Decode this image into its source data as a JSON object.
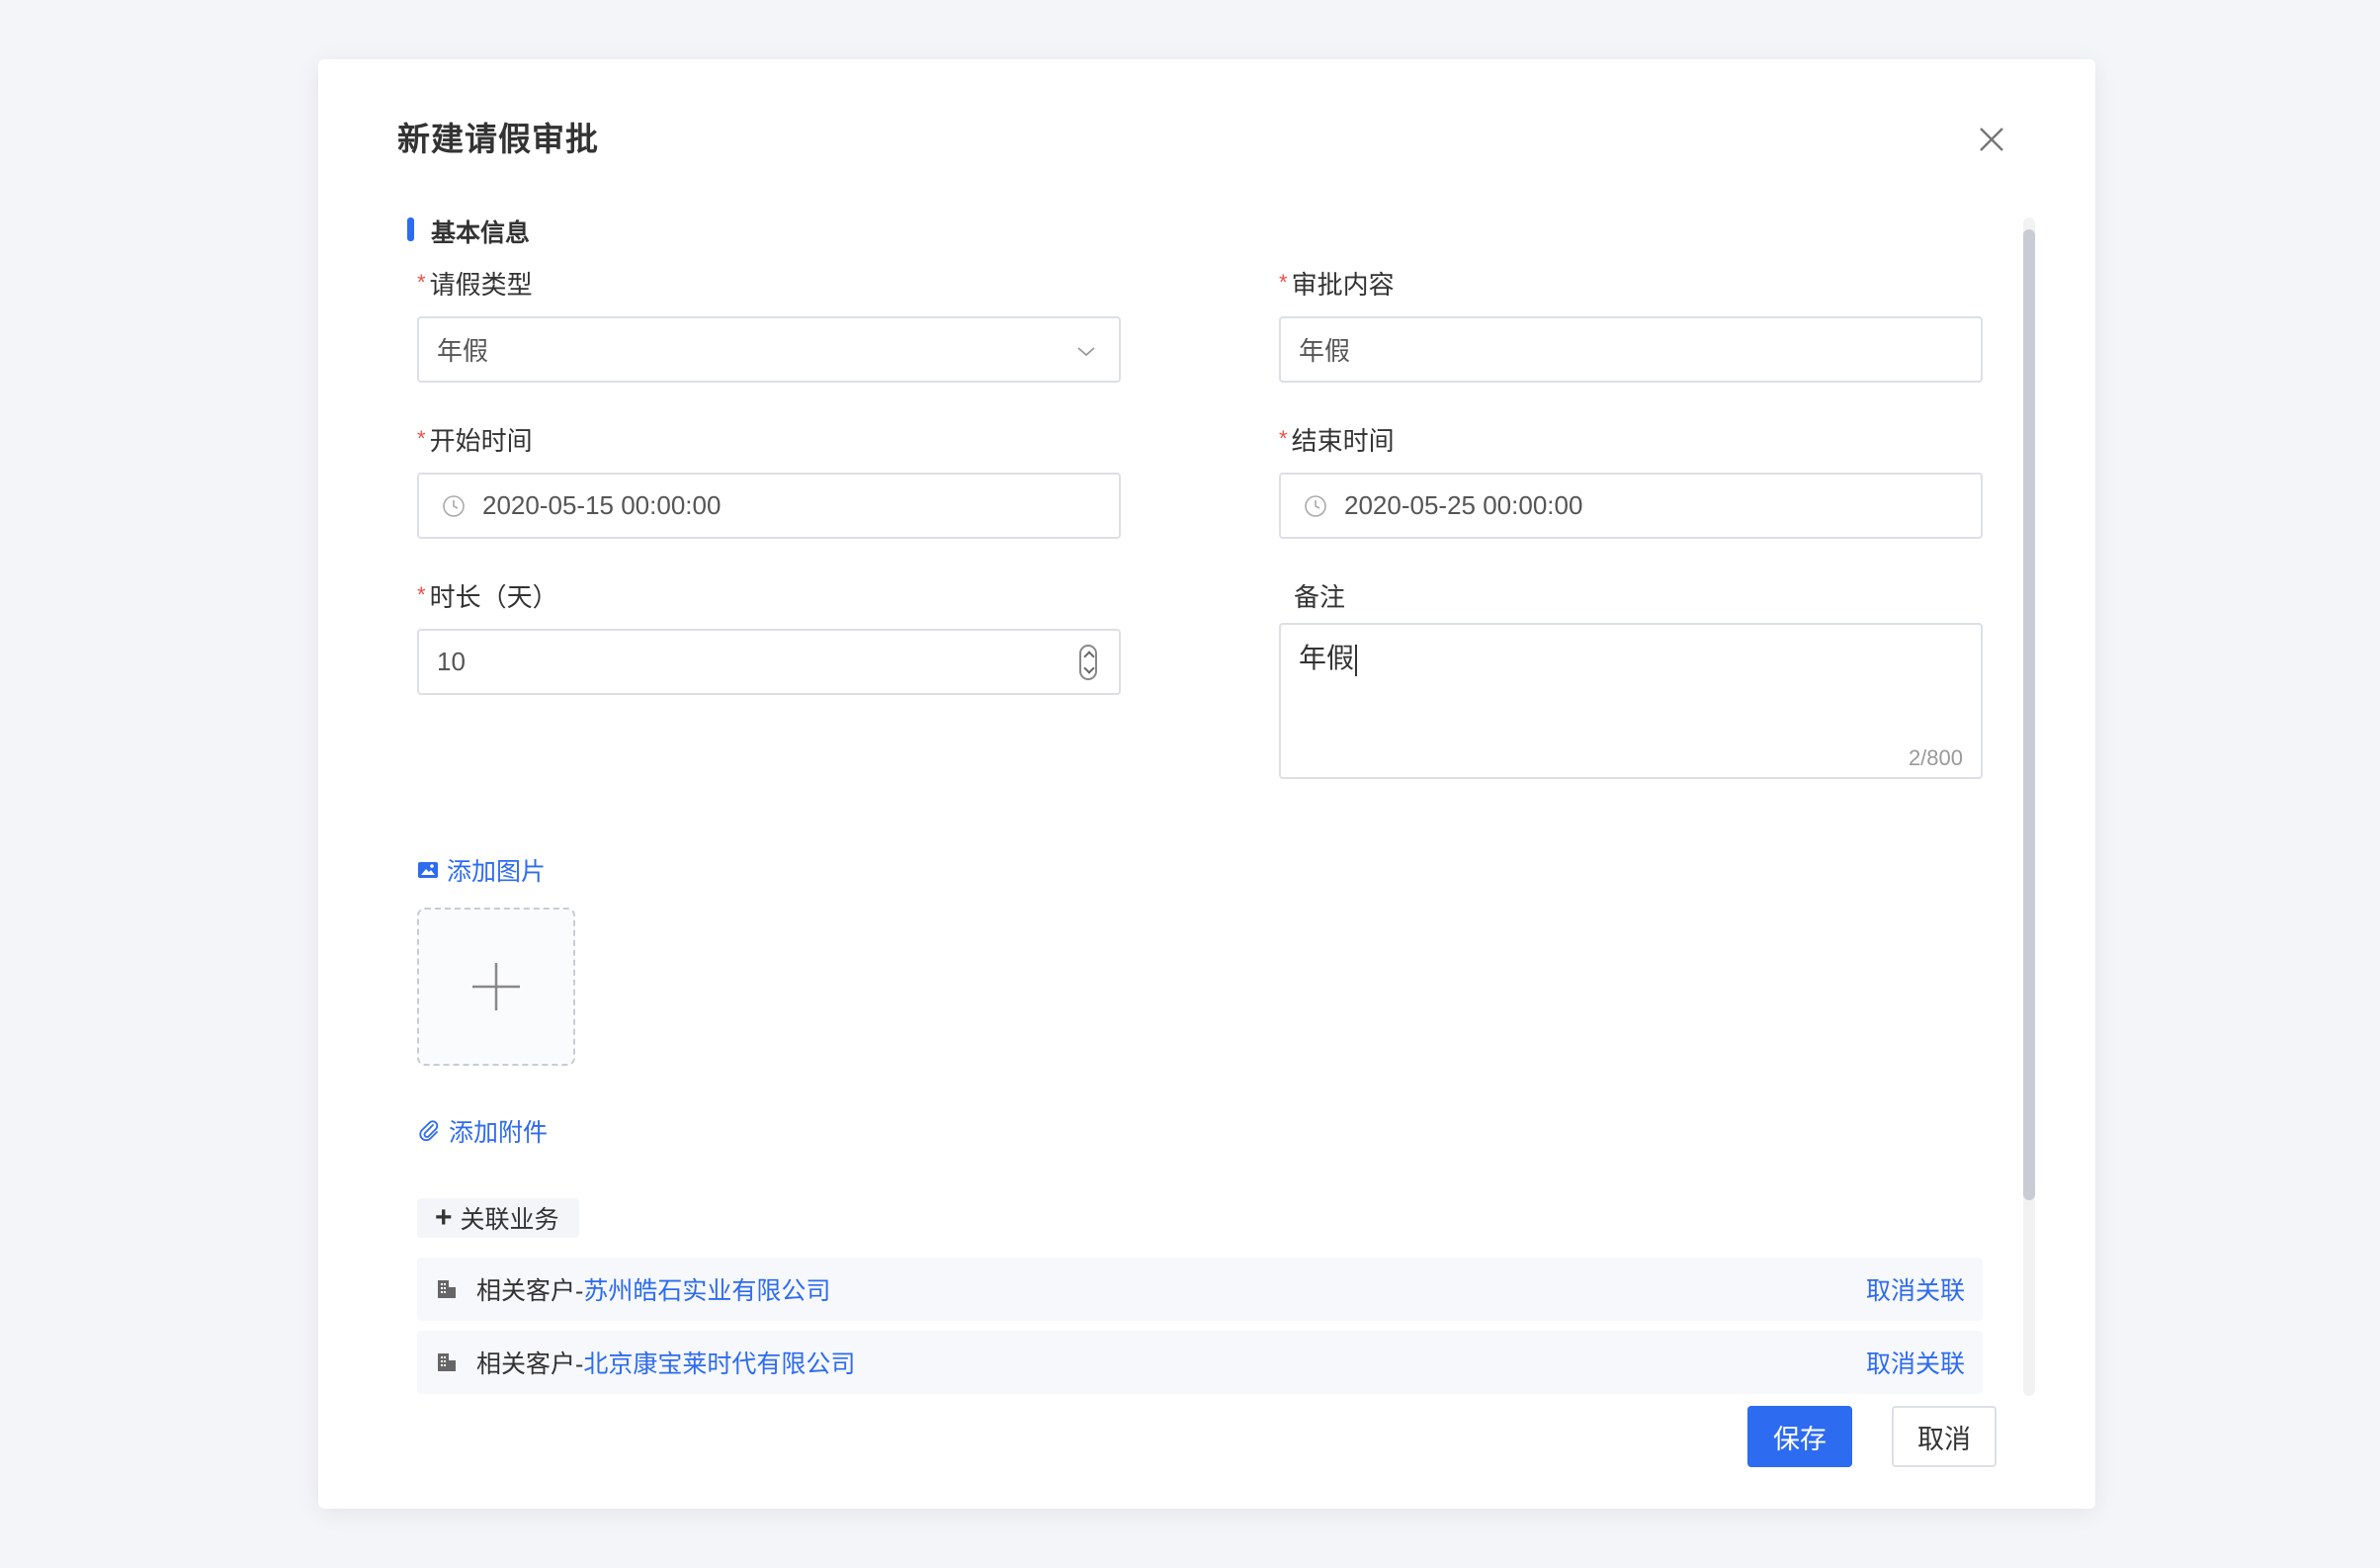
{
  "dialog": {
    "title": "新建请假审批",
    "close_icon": "close-icon"
  },
  "section": {
    "title": "基本信息"
  },
  "fields": {
    "leave_type": {
      "label": "请假类型",
      "required": "*",
      "value": "年假"
    },
    "approval_content": {
      "label": "审批内容",
      "required": "*",
      "value": "年假"
    },
    "start_time": {
      "label": "开始时间",
      "required": "*",
      "value": "2020-05-15 00:00:00"
    },
    "end_time": {
      "label": "结束时间",
      "required": "*",
      "value": "2020-05-25 00:00:00"
    },
    "duration": {
      "label": "时长（天）",
      "required": "*",
      "value": "10"
    },
    "remark": {
      "label": "备注",
      "value": "年假",
      "counter": "2/800"
    }
  },
  "attachments": {
    "add_image": "添加图片",
    "add_file": "添加附件"
  },
  "related": {
    "add_label": "关联业务",
    "items": [
      {
        "prefix": "相关客户-",
        "name": "苏州皓石实业有限公司",
        "action": "取消关联"
      },
      {
        "prefix": "相关客户-",
        "name": "北京康宝莱时代有限公司",
        "action": "取消关联"
      }
    ]
  },
  "footer": {
    "save": "保存",
    "cancel": "取消"
  },
  "colors": {
    "primary": "#2d6bf0",
    "required": "#f04e44"
  }
}
